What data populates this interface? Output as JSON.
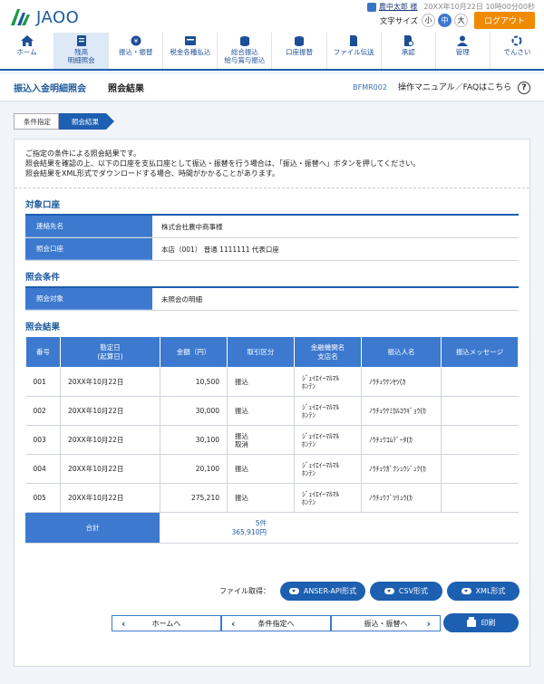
{
  "brand": {
    "logo_text": "JAOO"
  },
  "user": {
    "name": "農中太郎 様",
    "login_time": "20XX年10月22日 10時00分00秒"
  },
  "text_size": {
    "label": "文字サイズ",
    "options": [
      "小",
      "中",
      "大"
    ],
    "selected": "中"
  },
  "logout_label": "ログアウト",
  "nav": [
    {
      "label": "ホーム",
      "icon": "home-icon"
    },
    {
      "label": "残高\n明細照会",
      "icon": "balance-icon",
      "active": true
    },
    {
      "label": "振込・振替",
      "icon": "transfer-icon"
    },
    {
      "label": "税金各種払込",
      "icon": "tax-icon"
    },
    {
      "label": "総合振込\n給与賞与振込",
      "icon": "bulk-transfer-icon"
    },
    {
      "label": "口座振替",
      "icon": "account-transfer-icon"
    },
    {
      "label": "ファイル伝送",
      "icon": "file-transfer-icon"
    },
    {
      "label": "承認",
      "icon": "approval-icon"
    },
    {
      "label": "管理",
      "icon": "admin-icon"
    },
    {
      "label": "でんさい",
      "icon": "densai-icon"
    }
  ],
  "page": {
    "title": "振込入金明細照会",
    "subtitle": "照会結果",
    "screen_code": "BFMR002",
    "help_label": "操作マニュアル／FAQはこちら",
    "help_icon": "?"
  },
  "steps": [
    "条件指定",
    "照会結果"
  ],
  "intro": [
    "ご指定の条件による照会結果です。",
    "照会結果を確認の上、以下の口座を支払口座として振込・振替を行う場合は、「振込・振替へ」ボタンを押してください。",
    "照会結果をXML形式でダウンロードする場合、時間がかかることがあります。"
  ],
  "account_section": {
    "title": "対象口座",
    "rows": [
      {
        "key": "連絡先名",
        "value": "株式会社農中商事様"
      },
      {
        "key": "照会口座",
        "value": "本店（001） 普通 1111111 代表口座"
      }
    ]
  },
  "condition_section": {
    "title": "照会条件",
    "rows": [
      {
        "key": "照会対象",
        "value": "未照会の明細"
      }
    ]
  },
  "results": {
    "title": "照会結果",
    "headers": [
      "番号",
      "勘定日\n(起算日)",
      "金額（円）",
      "取引区分",
      "金融機関名\n支店名",
      "振込人名",
      "振込メッセージ"
    ],
    "rows": [
      [
        "001",
        "20XX年10月22日",
        "10,500",
        "振込",
        "ｼﾞｪｲｴｲｰﾏﾙﾏﾙ\nﾎﾝﾃﾝ",
        "ﾉｳﾁｭｳｹﾝｾﾂ(ｶ",
        ""
      ],
      [
        "002",
        "20XX年10月22日",
        "30,000",
        "振込",
        "ｼﾞｪｲｴｲｰﾏﾙﾏﾙ\nﾎﾝﾃﾝ",
        "ﾉｳﾁｭｳｹﾐｶﾙｺｳｷﾞｮｳ(ｶ",
        ""
      ],
      [
        "003",
        "20XX年10月22日",
        "30,100",
        "振込\n取消",
        "ｼﾞｪｲｴｲｰﾏﾙﾏﾙ\nﾎﾝﾃﾝ",
        "ﾉｳﾁｭｳｺﾑﾃﾞｰﾀ(ｶ",
        ""
      ],
      [
        "004",
        "20XX年10月22日",
        "20,100",
        "振込",
        "ｼﾞｪｲｴｲｰﾏﾙﾏﾙ\nﾎﾝﾃﾝ",
        "ﾉｳﾁｭｳｶﾞｸｼｭｳｼﾞｭｸ(ｶ",
        ""
      ],
      [
        "005",
        "20XX年10月22日",
        "275,210",
        "振込",
        "ｼﾞｪｲｴｲｰﾏﾙﾏﾙ\nﾎﾝﾃﾝ",
        "ﾉｳﾁｭｳﾌﾞﾂﾘｭｳ(ｶ",
        ""
      ]
    ],
    "total_label": "合計",
    "total_count": "5件",
    "total_amount": "365,910円"
  },
  "download": {
    "label": "ファイル取得：",
    "buttons": [
      "ANSER-API形式",
      "CSV形式",
      "XML形式"
    ]
  },
  "footer_nav": {
    "home": "ホームへ",
    "condition": "条件指定へ",
    "transfer": "振込・振替へ",
    "print": "印刷"
  },
  "colors": {
    "primary": "#1d5fb0",
    "header_cell": "#3c79cf",
    "logout": "#f08a00",
    "brand": "#1d5a9c"
  }
}
